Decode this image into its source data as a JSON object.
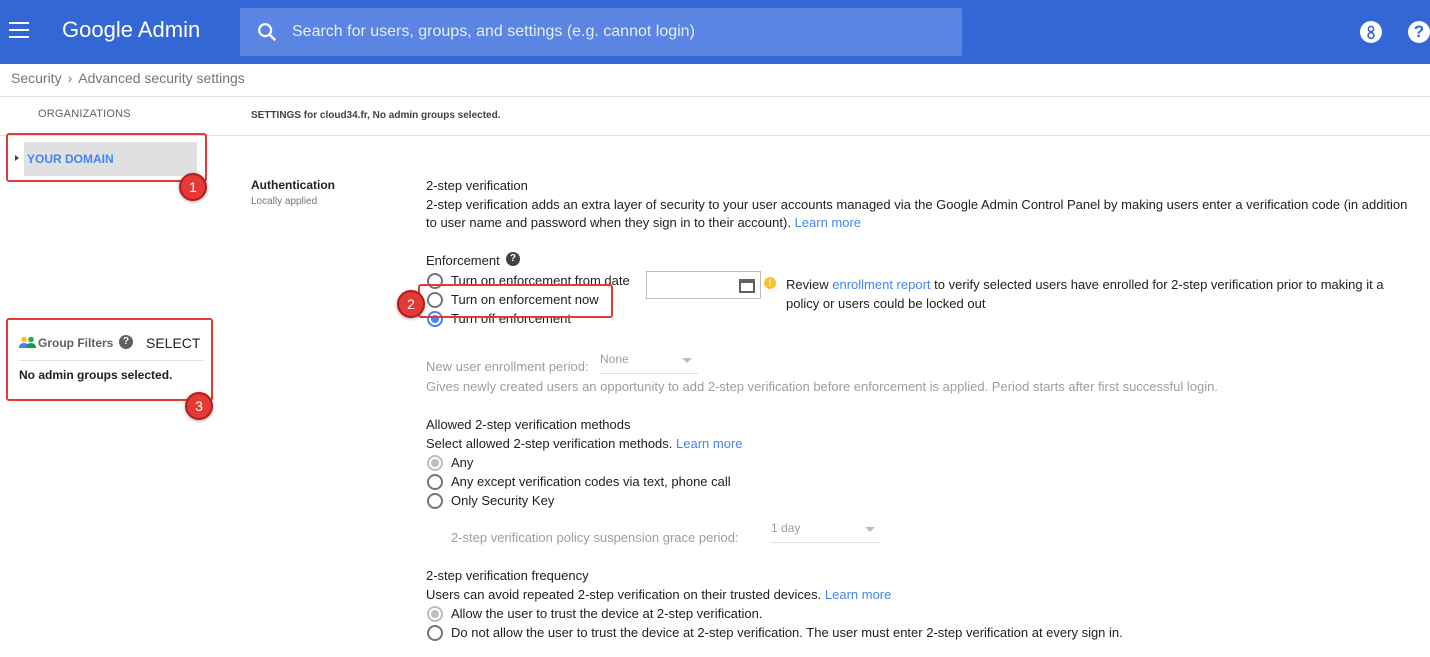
{
  "header": {
    "brand": "Google Admin",
    "search_placeholder": "Search for users, groups, and settings (e.g. cannot login)"
  },
  "breadcrumb": [
    "Security",
    "Advanced security settings"
  ],
  "sidebar": {
    "organizations_heading": "ORGANIZATIONS",
    "domain_label": "YOUR DOMAIN",
    "group_filters": {
      "title": "Group Filters",
      "select_label": "SELECT",
      "empty_text": "No admin groups selected."
    }
  },
  "settings_header": "SETTINGS for cloud34.fr, No admin groups selected.",
  "authentication": {
    "title": "Authentication",
    "subtitle": "Locally applied"
  },
  "two_step": {
    "title": "2-step verification",
    "description_line1": "2-step verification adds an extra layer of security to your user accounts managed via the Google Admin Control Panel by making users enter a verification code (in addition",
    "description_line2": "to user name and password when they sign in to their account).",
    "learn_more": "Learn more"
  },
  "enforcement": {
    "label": "Enforcement",
    "options": [
      {
        "label": "Turn on enforcement from date",
        "selected": false
      },
      {
        "label": "Turn on enforcement now",
        "selected": false
      },
      {
        "label": "Turn off enforcement",
        "selected": true
      }
    ],
    "review_prefix": "Review",
    "review_link": "enrollment report",
    "review_suffix": "to verify selected users have enrolled for 2-step verification prior to making it a",
    "review_line2": "policy or users could be locked out"
  },
  "enrollment": {
    "label": "New user enrollment period:",
    "value": "None",
    "help": "Gives newly created users an opportunity to add 2-step verification before enforcement is applied. Period starts after first successful login."
  },
  "methods": {
    "title": "Allowed 2-step verification methods",
    "description": "Select allowed 2-step verification methods.",
    "learn_more": "Learn more",
    "options": [
      {
        "label": "Any",
        "selected": true
      },
      {
        "label": "Any except verification codes via text, phone call",
        "selected": false
      },
      {
        "label": "Only Security Key",
        "selected": false
      }
    ],
    "grace_label": "2-step verification policy suspension grace period:",
    "grace_value": "1 day"
  },
  "frequency": {
    "title": "2-step verification frequency",
    "description": "Users can avoid repeated 2-step verification on their trusted devices.",
    "learn_more": "Learn more",
    "options": [
      {
        "label": "Allow the user to trust the device at 2-step verification.",
        "selected": true
      },
      {
        "label": "Do not allow the user to trust the device at 2-step verification. The user must enter 2-step verification at every sign in.",
        "selected": false
      }
    ]
  },
  "annotations": [
    "1",
    "2",
    "3"
  ],
  "colors": {
    "topbar": "#3367d6",
    "accent": "#4285f4",
    "annotation": "#e53935"
  }
}
